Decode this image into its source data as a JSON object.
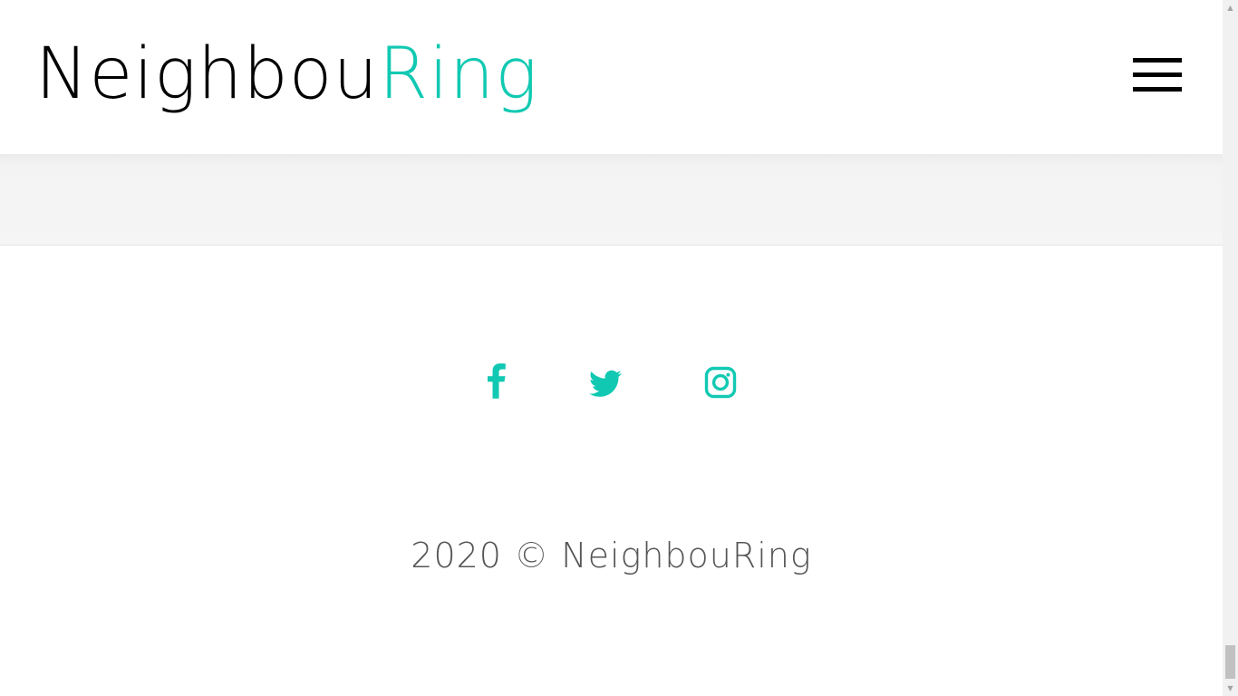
{
  "header": {
    "logo_part_a": "Neighbou",
    "logo_part_b": "Ring",
    "menu_icon": "hamburger-menu-icon"
  },
  "footer": {
    "social": [
      {
        "name": "facebook",
        "icon": "facebook-icon"
      },
      {
        "name": "twitter",
        "icon": "twitter-icon"
      },
      {
        "name": "instagram",
        "icon": "instagram-icon"
      }
    ],
    "copyright": "2020 © NeighbouRing"
  },
  "scrollbar": {
    "up_arrow": "▲",
    "down_arrow": "▼"
  },
  "colors": {
    "accent": "#11c9b2",
    "logo_dark": "#000000",
    "band_background": "#f5f5f5",
    "copyright_text": "#555555"
  }
}
